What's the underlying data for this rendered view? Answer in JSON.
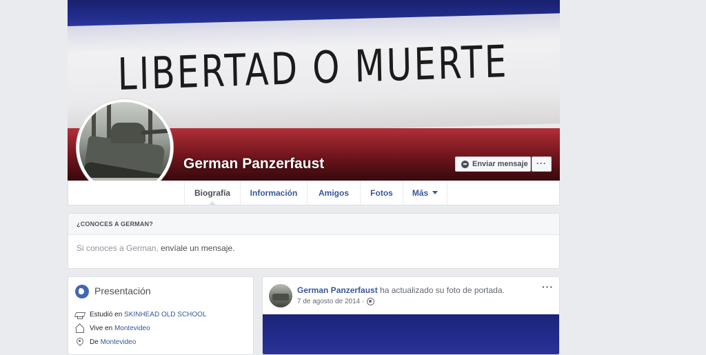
{
  "cover": {
    "slogan": "LIBERTAD O MUERTE",
    "colors": {
      "blue": "#1c2478",
      "white": "#ececee",
      "red": "#9a1e28"
    }
  },
  "profile": {
    "name": "German Panzerfaust",
    "send_message_label": "Enviar mensaje",
    "more_label": "···"
  },
  "tabs": [
    {
      "label": "Biografía",
      "active": true
    },
    {
      "label": "Información",
      "active": false
    },
    {
      "label": "Amigos",
      "active": false
    },
    {
      "label": "Fotos",
      "active": false
    },
    {
      "label": "Más",
      "active": false
    }
  ],
  "know_card": {
    "header": "¿CONOCES A GERMAN?",
    "text_prefix": "Si conoces a German,",
    "text_link": "envíale un mensaje."
  },
  "intro": {
    "title": "Presentación",
    "items": [
      {
        "icon": "graduation-cap-icon",
        "prefix": "Estudió en",
        "value": "SKINHEAD OLD SCHOOL"
      },
      {
        "icon": "home-icon",
        "prefix": "Vive en",
        "value": "Montevideo"
      },
      {
        "icon": "location-pin-icon",
        "prefix": "De",
        "value": "Montevideo"
      }
    ]
  },
  "post": {
    "author": "German Panzerfaust",
    "action": "ha actualizado su foto de portada.",
    "date": "7 de agosto de 2014 ·",
    "options_label": "···"
  },
  "accent_colors": {
    "link": "#365899",
    "fb_blue": "#4267b2",
    "background": "#e9ebee"
  }
}
